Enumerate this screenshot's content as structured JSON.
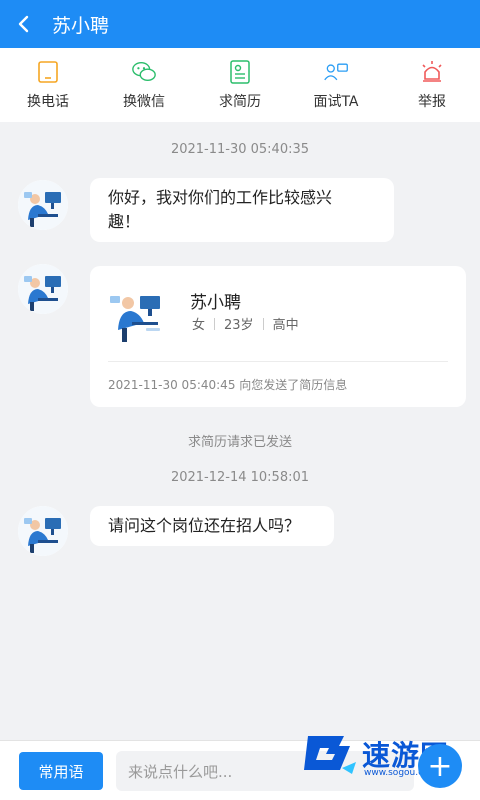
{
  "header": {
    "title": "苏小聘",
    "back_icon": "chevron-left-icon",
    "bg_color": "#1e8cf5"
  },
  "actions": [
    {
      "label": "换电话",
      "icon": "phone-icon",
      "color": "#f5a623"
    },
    {
      "label": "换微信",
      "icon": "wechat-icon",
      "color": "#2bbd6b"
    },
    {
      "label": "求简历",
      "icon": "resume-icon",
      "color": "#2bbd6b"
    },
    {
      "label": "面试TA",
      "icon": "interview-icon",
      "color": "#2a9df4"
    },
    {
      "label": "举报",
      "icon": "alarm-icon",
      "color": "#f05a5a"
    }
  ],
  "chat": {
    "ts1": "2021-11-30 05:40:35",
    "msg1_line1": "你好，我对你们的工作比较感兴",
    "msg1_line2": "趣！",
    "card": {
      "name": "苏小聘",
      "gender": "女",
      "age": "23岁",
      "education": "高中",
      "footer": "2021-11-30 05:40:45 向您发送了简历信息"
    },
    "system_note": "求简历请求已发送",
    "ts2": "2021-12-14 10:58:01",
    "msg2": "请问这个岗位还在招人吗？"
  },
  "bottom": {
    "phrase_label": "常用语",
    "input_placeholder": "来说点什么吧...",
    "plus_symbol": "+"
  },
  "watermark": {
    "text": "速游网",
    "sub": "www.sogou.com"
  }
}
